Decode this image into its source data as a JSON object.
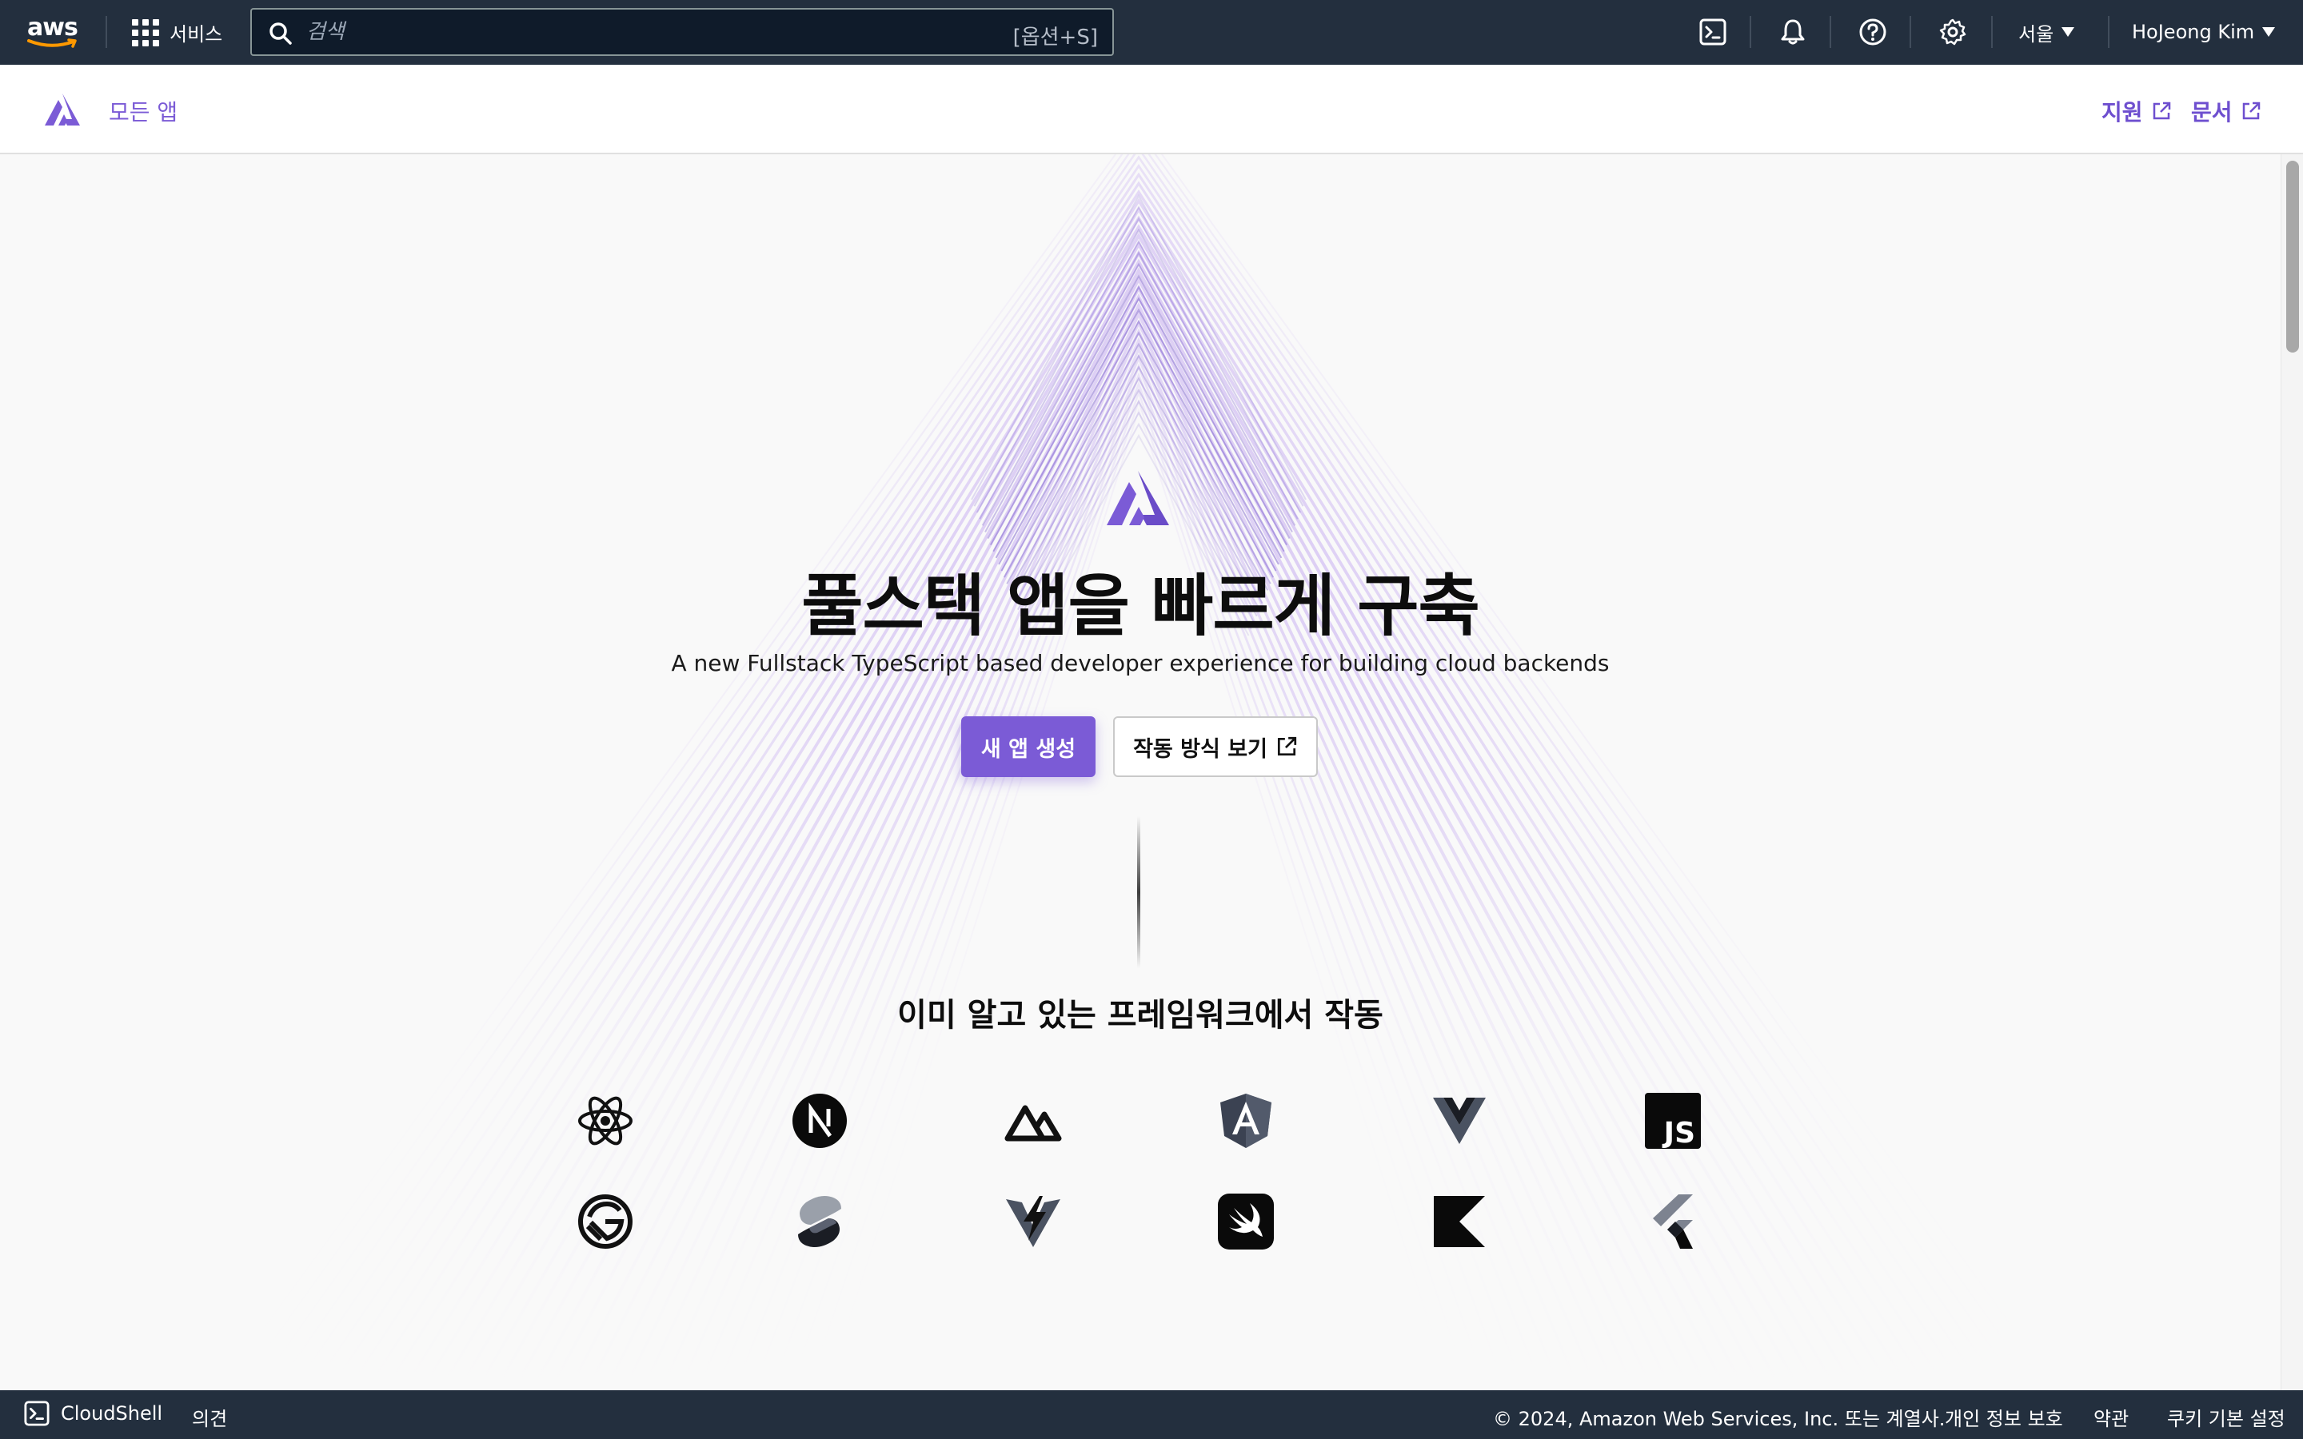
{
  "topnav": {
    "logo_text": "aws",
    "services_label": "서비스",
    "search_placeholder": "검색",
    "search_shortcut": "[옵션+S]",
    "region_label": "서울",
    "user_label": "HoJeong Kim"
  },
  "subheader": {
    "all_apps_label": "모든 앱",
    "support_label": "지원",
    "docs_label": "문서"
  },
  "hero": {
    "title": "풀스택 앱을 빠르게 구축",
    "subtitle": "A new Fullstack TypeScript based developer experience for building cloud backends",
    "primary_button": "새 앱 생성",
    "secondary_button": "작동 방식 보기"
  },
  "frameworks": {
    "title": "이미 알고 있는 프레임워크에서 작동",
    "icons": [
      "react-icon",
      "nextjs-icon",
      "nuxt-icon",
      "angular-icon",
      "vue-icon",
      "javascript-icon",
      "gatsby-icon",
      "svelte-icon",
      "vite-icon",
      "swift-icon",
      "kotlin-icon",
      "flutter-icon"
    ]
  },
  "footer": {
    "cloudshell_label": "CloudShell",
    "feedback_label": "의견",
    "copyright": "© 2024, Amazon Web Services, Inc. 또는 계열사.",
    "privacy_label": "개인 정보 보호",
    "terms_label": "약관",
    "cookie_label": "쿠키 기본 설정"
  },
  "colors": {
    "nav_bg": "#232f3e",
    "accent": "#7b5bd6",
    "page_bg": "#f9f9f9"
  }
}
